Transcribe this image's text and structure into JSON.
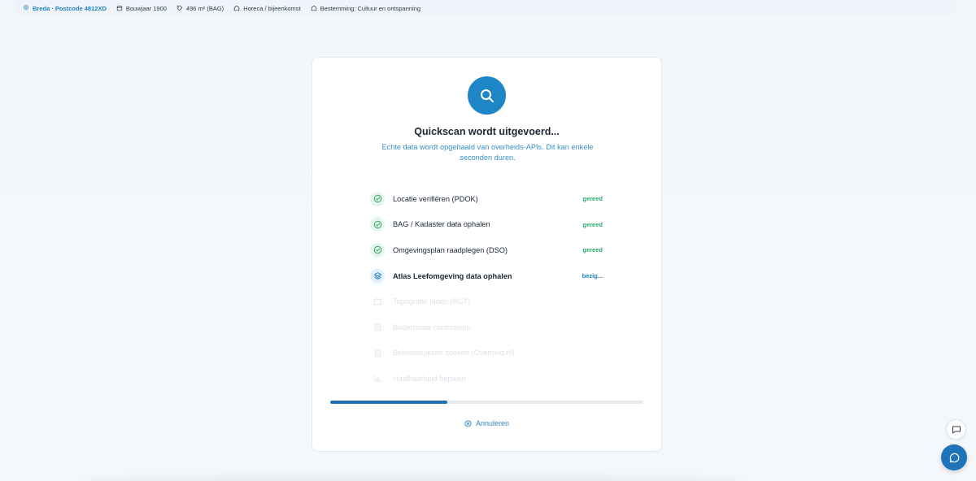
{
  "infobar": {
    "location": "Breda · Postcode 4812XD",
    "year": "Bouwjaar 1900",
    "area": "496 m² (BAG)",
    "usage": "Horeca / bijeenkomst",
    "destination": "Bestemming: Cultuur en ontspanning"
  },
  "card": {
    "title": "Quickscan wordt uitgevoerd...",
    "subtitle": "Echte data wordt opgehaald van overheids-APIs. Dit kan enkele seconden duren.",
    "steps": [
      {
        "label": "Locatie verifiëren (PDOK)",
        "status": "gereed",
        "state": "done",
        "icon": "check-circle-icon"
      },
      {
        "label": "BAG / Kadaster data ophalen",
        "status": "gereed",
        "state": "done",
        "icon": "check-circle-icon"
      },
      {
        "label": "Omgevingsplan raadplegen (DSO)",
        "status": "gereed",
        "state": "done",
        "icon": "check-circle-icon"
      },
      {
        "label": "Atlas Leefomgeving data ophalen",
        "status": "bezig...",
        "state": "active",
        "icon": "layers-icon"
      },
      {
        "label": "Topografie laden (BGT)",
        "status": "",
        "state": "pending",
        "icon": "map-icon"
      },
      {
        "label": "Bodemdata controleren",
        "status": "",
        "state": "pending",
        "icon": "clipboard-icon"
      },
      {
        "label": "Beleidsstukken zoeken (Overheid.nl)",
        "status": "",
        "state": "pending",
        "icon": "document-icon"
      },
      {
        "label": "Haalbaarheid bepalen",
        "status": "",
        "state": "pending",
        "icon": "chart-icon"
      }
    ],
    "progress": 0.375,
    "cancel_label": "Annuleren"
  },
  "colors": {
    "accent": "#1e86c7",
    "done": "#2ba86a",
    "progress": "#1f6fb2"
  }
}
